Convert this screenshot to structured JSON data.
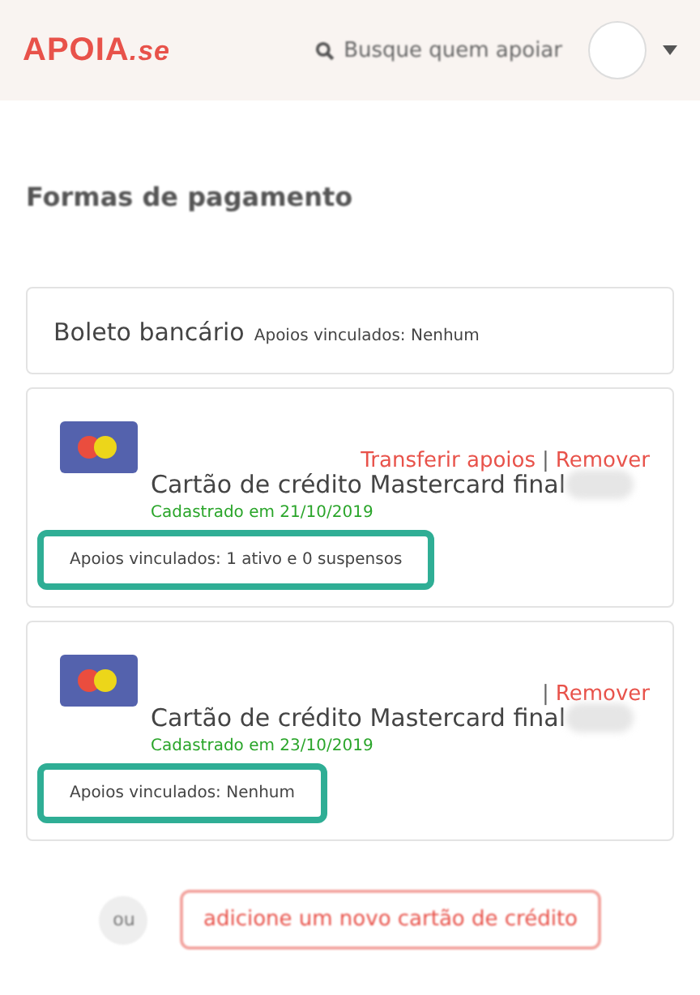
{
  "header": {
    "logo": {
      "main": "APOIA",
      "suffix": ".se"
    },
    "search": {
      "placeholder": "Busque quem apoiar"
    }
  },
  "page_title": "Formas de pagamento",
  "boleto": {
    "title": "Boleto bancário",
    "linked": "Apoios vinculados: Nenhum"
  },
  "cards": [
    {
      "actions": [
        {
          "kind": "link",
          "text": "Transferir apoios"
        },
        {
          "kind": "separator",
          "text": "|"
        },
        {
          "kind": "link",
          "text": "Remover"
        }
      ],
      "title": "Cartão de crédito Mastercard final",
      "registered": "Cadastrado em 21/10/2019",
      "linked": "Apoios vinculados: 1 ativo e 0 suspensos",
      "highlighted": true
    },
    {
      "actions": [
        {
          "kind": "separator",
          "text": "|"
        },
        {
          "kind": "link",
          "text": "Remover"
        }
      ],
      "title": "Cartão de crédito Mastercard final",
      "registered": "Cadastrado em 23/10/2019",
      "linked": "Apoios vinculados: Nenhum",
      "highlighted": true
    }
  ],
  "footer": {
    "or": "ou",
    "add_button": "adicione um novo cartão de crédito"
  }
}
